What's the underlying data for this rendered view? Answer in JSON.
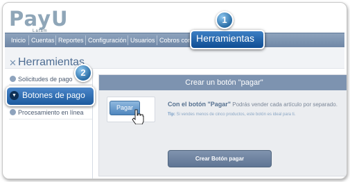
{
  "logo": {
    "main": "PayU",
    "sub": "Latam"
  },
  "nav": {
    "items": [
      "Inicio",
      "Cuentas",
      "Reportes",
      "Configuración",
      "Usuarios",
      "Cobros con"
    ],
    "active_label": "Herramientas"
  },
  "callouts": {
    "step1": "1",
    "step2": "2"
  },
  "sidebar": {
    "title": "Herramientas",
    "items": [
      "Solicitudes de pago",
      "Botones de pago",
      "Procesamiento en línea"
    ],
    "active_index": 1
  },
  "panel": {
    "header": "Crear un botón \"pagar\"",
    "pay_button_label": "Pagar",
    "description_bold": "Con el botón \"Pagar\"",
    "description_rest": " Podrás vender cada artículo por separado.",
    "tip_label": "Tip:",
    "tip_text": " Si vendes menos de cinco productos, este botón es ideal para ti.",
    "create_button_label": "Crear Botón pagar"
  },
  "colors": {
    "nav": "#7d93b0",
    "accent": "#1c5a9e",
    "panel_bg": "#ebedf0",
    "logo": "#8fa6b8"
  },
  "icons": {
    "tools": "tools-icon",
    "bullet": "circle-arrow-icon",
    "active_bullet": "chevron-down-icon",
    "cursor": "hand-pointer-icon"
  }
}
